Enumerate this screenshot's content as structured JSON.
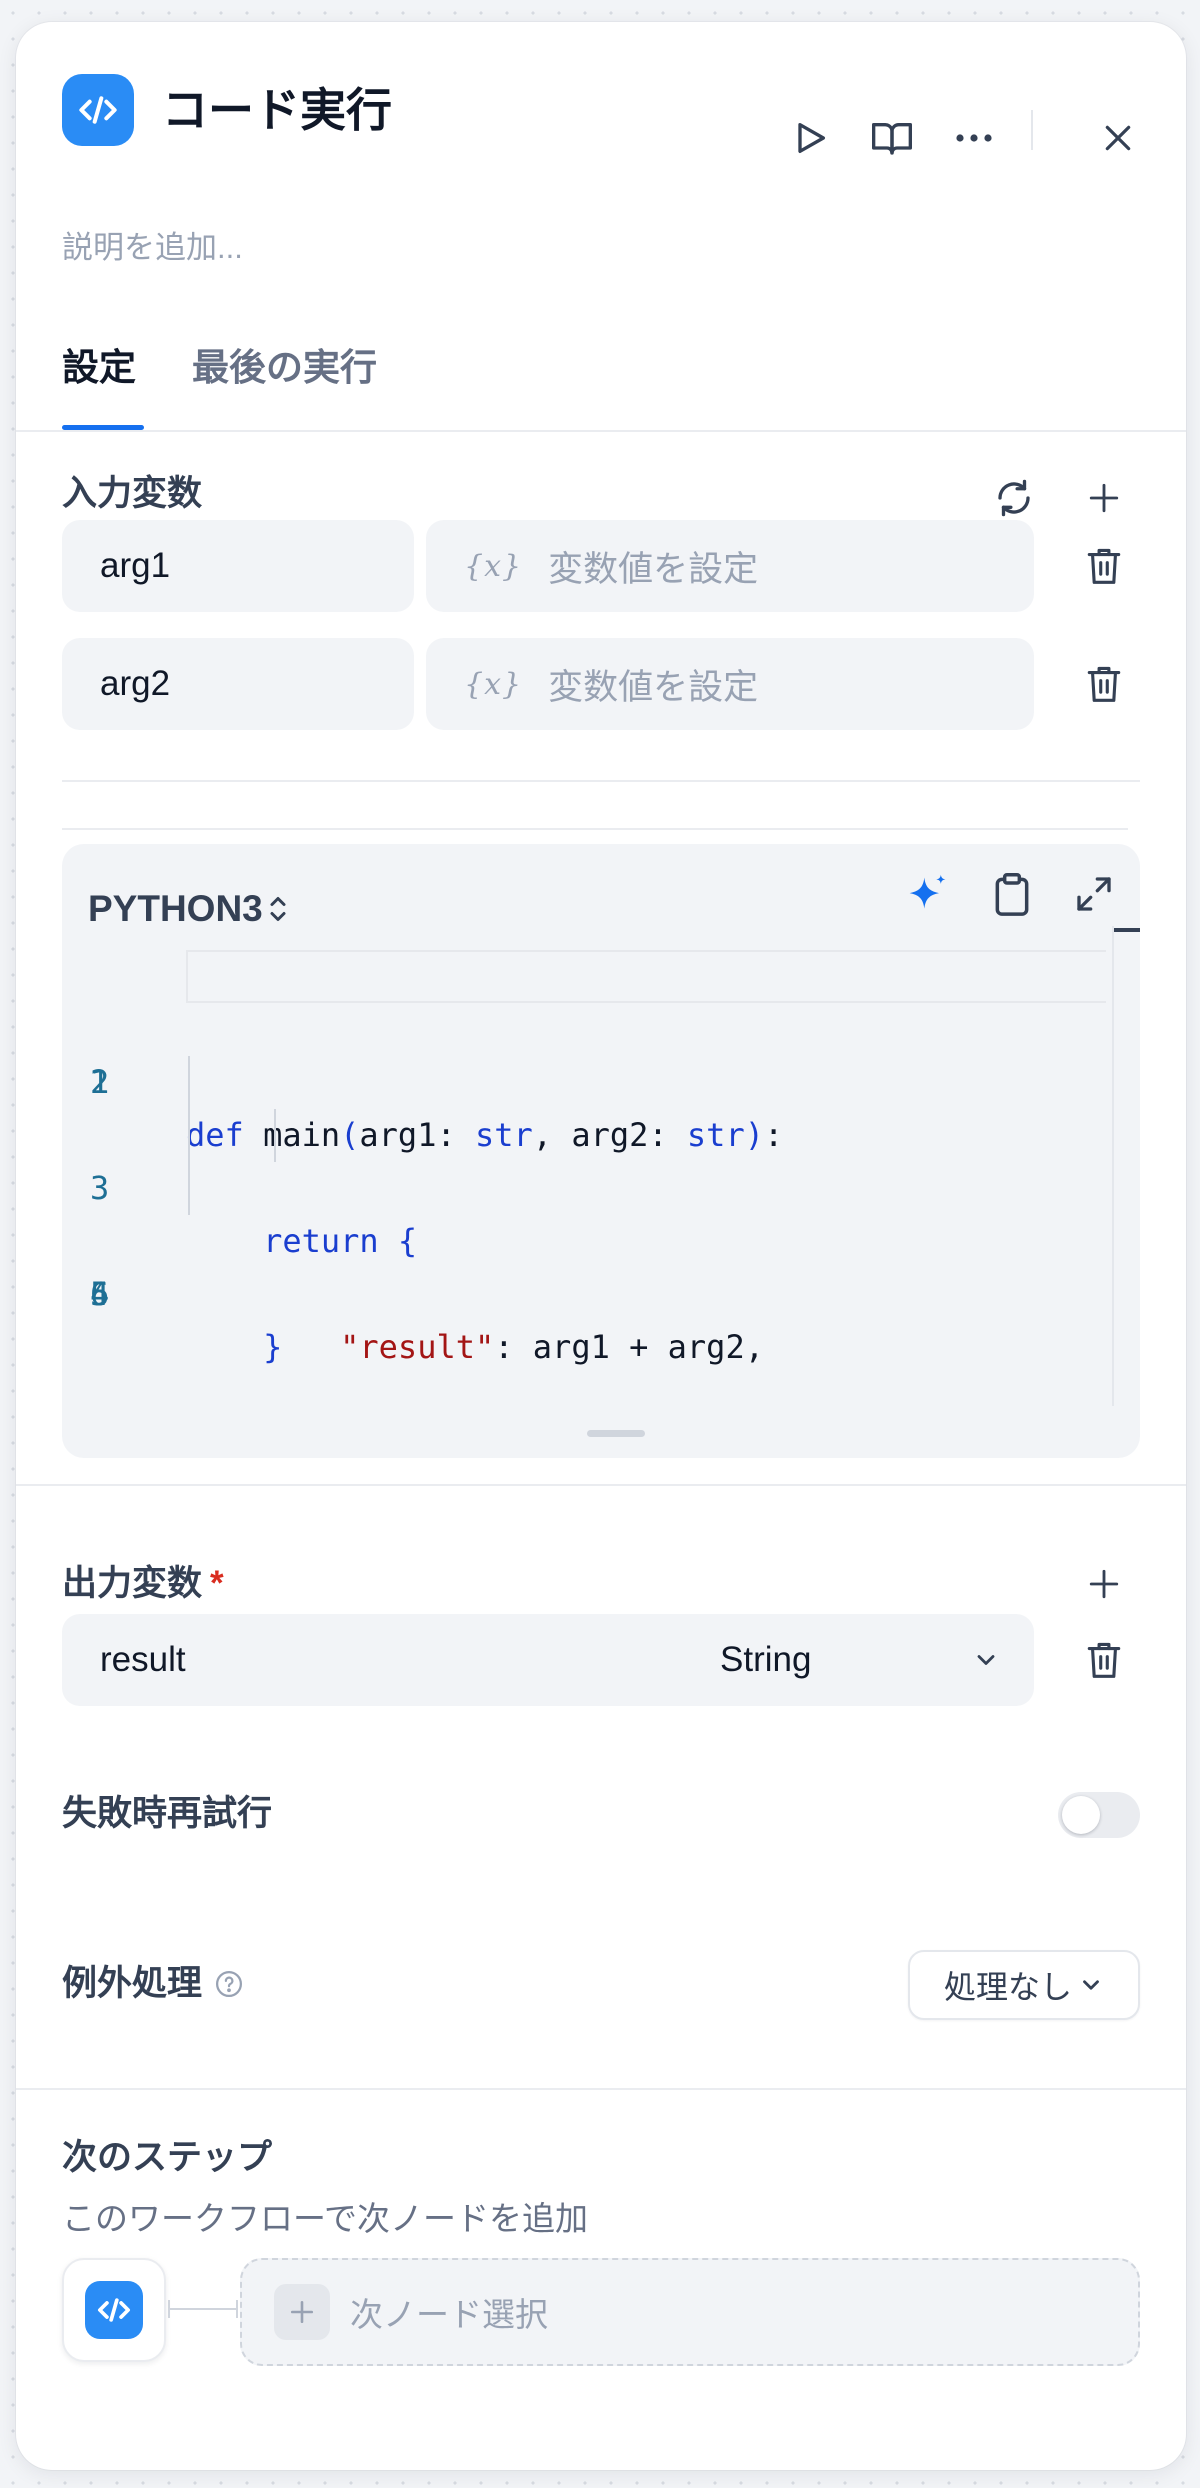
{
  "header": {
    "title": "コード実行",
    "description_placeholder": "説明を追加..."
  },
  "tabs": [
    {
      "label": "設定",
      "active": true
    },
    {
      "label": "最後の実行",
      "active": false
    }
  ],
  "input_vars": {
    "title": "入力変数",
    "items": [
      {
        "name": "arg1",
        "value_badge": "{x}",
        "value_placeholder": "変数値を設定"
      },
      {
        "name": "arg2",
        "value_badge": "{x}",
        "value_placeholder": "変数値を設定"
      }
    ]
  },
  "code_editor": {
    "language": "PYTHON3",
    "line_numbers": [
      "1",
      "2",
      "3",
      "4",
      "5",
      "6"
    ],
    "lines": [
      "",
      "def main(arg1: str, arg2: str):",
      "    return {",
      "        \"result\": arg1 + arg2,",
      "    }",
      ""
    ]
  },
  "output_vars": {
    "title": "出力変数",
    "required_mark": "*",
    "items": [
      {
        "name": "result",
        "type": "String"
      }
    ]
  },
  "retry": {
    "label": "失敗時再試行",
    "enabled": false
  },
  "exception": {
    "label": "例外処理",
    "value": "処理なし"
  },
  "next_step": {
    "title": "次のステップ",
    "subtitle": "このワークフローで次ノードを追加",
    "select_label": "次ノード選択"
  },
  "colors": {
    "accent": "#2a8cf5",
    "tab_underline": "#1570ef",
    "keyword": "#1a3ecf",
    "string": "#a31515",
    "required": "#d92d20"
  }
}
